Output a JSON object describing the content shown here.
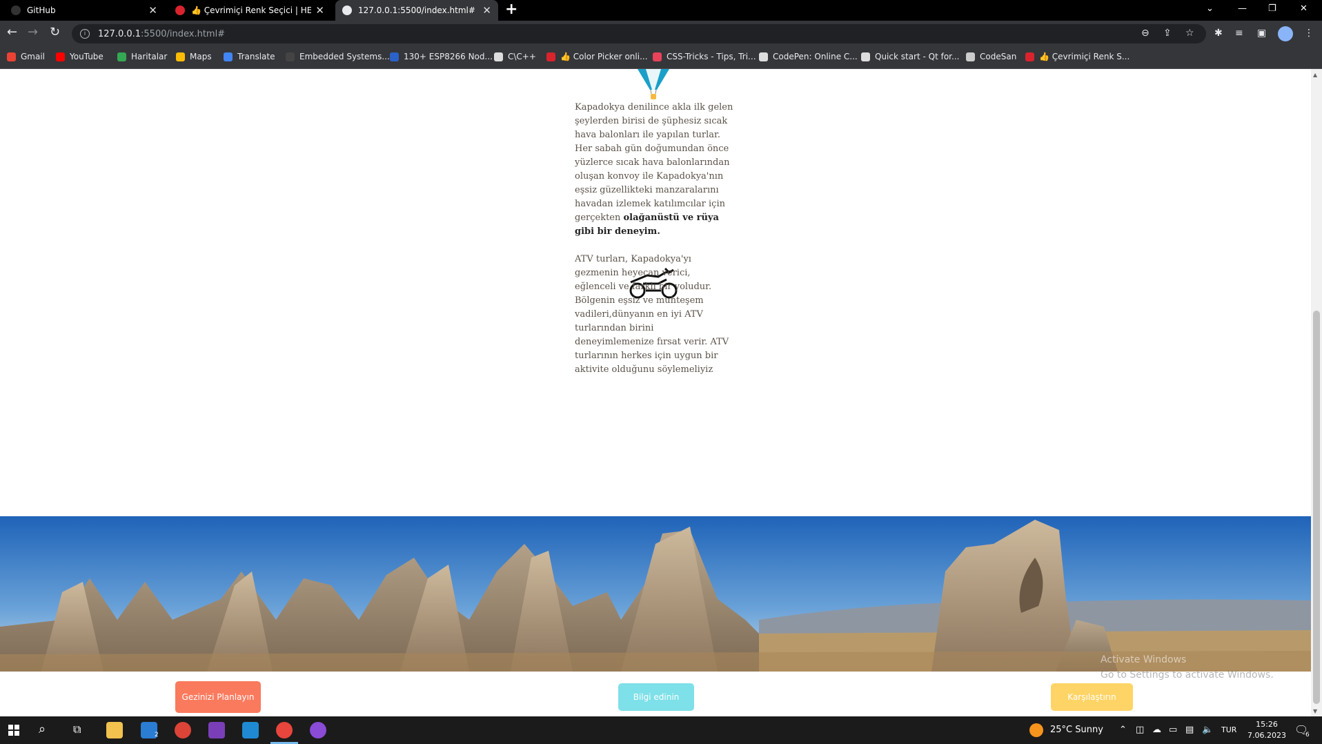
{
  "browser": {
    "tabs": [
      {
        "title": "GitHub",
        "favicon": "github-icon"
      },
      {
        "title": "👍 Çevrimiçi Renk Seçici | HEX Re",
        "favicon": "colorpicker-icon"
      },
      {
        "title": "127.0.0.1:5500/index.html#",
        "favicon": "globe-icon",
        "active": true
      }
    ],
    "url_host": "127.0.0.1",
    "url_path": ":5500/index.html#",
    "bookmarks": [
      {
        "label": "Gmail",
        "color": "#ea4335"
      },
      {
        "label": "YouTube",
        "color": "#ff0000"
      },
      {
        "label": "Haritalar",
        "color": "#34a853"
      },
      {
        "label": "Maps",
        "color": "#fbbc04"
      },
      {
        "label": "Translate",
        "color": "#4285f4"
      },
      {
        "label": "Embedded Systems...",
        "color": "#444444"
      },
      {
        "label": "130+ ESP8266 Nod...",
        "color": "#2a62c9"
      },
      {
        "label": "C\\C++",
        "color": "#dddddd"
      },
      {
        "label": "👍 Color Picker onli...",
        "color": "#d9232d"
      },
      {
        "label": "CSS-Tricks - Tips, Tri...",
        "color": "#e8435a"
      },
      {
        "label": "CodePen: Online C...",
        "color": "#dddddd"
      },
      {
        "label": "Quick start - Qt for...",
        "color": "#dddddd"
      },
      {
        "label": "CodeSan",
        "color": "#cccccc"
      },
      {
        "label": "👍 Çevrimiçi Renk S...",
        "color": "#d9232d"
      }
    ]
  },
  "page": {
    "balloon": {
      "text_plain": "Kapadokya denilince akla ilk  gelen şeylerden birisi de şüphesiz sıcak hava balonları ile yapılan turlar. Her sabah  gün doğumundan önce yüzlerce sıcak hava balonlarından oluşan konvoy ile Kapadokya'nın eşsiz  güzellikteki manzaralarını havadan izlemek katılımcılar için gerçekten ",
      "text_bold": "olağanüstü ve  rüya gibi bir deneyim."
    },
    "atv": {
      "text": "ATV turları, Kapadokya'yı gezmenin heyecan verici, eğlenceli ve farklı bir yoludur. Bölgenin eşsiz ve muhteşem vadileri,dünyanın en iyi ATV turlarından birini deneyimlemenize fırsat verir. ATV turlarının herkes için uygun bir aktivite olduğunu söylemeliyiz"
    },
    "buttons": {
      "plan": "Gezinizi Planlayın",
      "info": "Bilgi edinin",
      "compare": "Karşılaştırın"
    },
    "colors": {
      "plan": "#fa7a5e",
      "info": "#7ee0e8",
      "compare": "#ffd466"
    }
  },
  "watermark": {
    "title": "Activate Windows",
    "subtitle": "Go to Settings to activate Windows."
  },
  "taskbar": {
    "weather": "25°C  Sunny",
    "lang": "TUR",
    "time": "15:26",
    "date": "7.06.2023",
    "notifications": "6",
    "mail_badge": "2"
  }
}
